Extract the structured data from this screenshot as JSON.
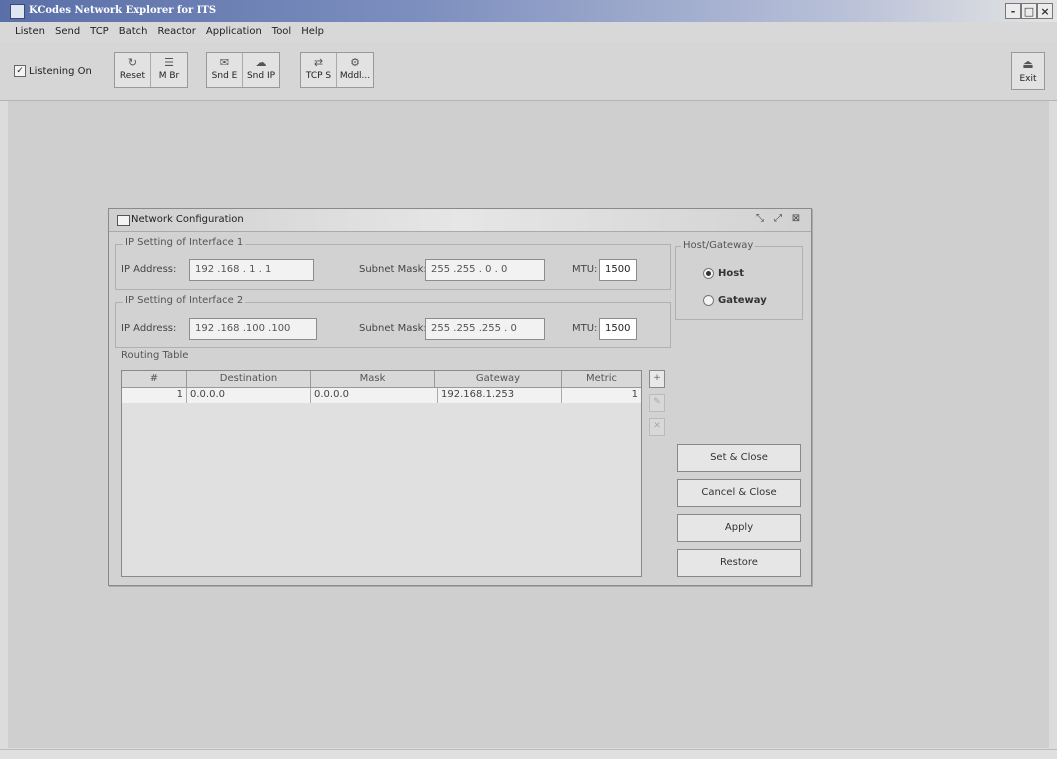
{
  "window": {
    "title": "KCodes Network Explorer for ITS",
    "min": "-",
    "max": "□",
    "close": "×"
  },
  "menu": [
    "Listen",
    "Send",
    "TCP",
    "Batch",
    "Reactor",
    "Application",
    "Tool",
    "Help"
  ],
  "toolbar": {
    "listening_label": "Listening On",
    "listening_checked": true,
    "group1": [
      {
        "label": "Reset",
        "icon": "reset-icon"
      },
      {
        "label": "M Br",
        "icon": "message-icon"
      }
    ],
    "group2": [
      {
        "label": "Snd E",
        "icon": "send-ethernet-icon"
      },
      {
        "label": "Snd IP",
        "icon": "send-ip-icon"
      }
    ],
    "group3": [
      {
        "label": "TCP S",
        "icon": "tcp-icon"
      },
      {
        "label": "Mddl...",
        "icon": "middleware-icon"
      }
    ],
    "exit_label": "Exit"
  },
  "dialog": {
    "title": "Network Configuration",
    "iface1": {
      "legend": "IP Setting of Interface 1",
      "ip_label": "IP Address:",
      "ip_value": "192 .168 .  1  .  1",
      "mask_label": "Subnet Mask:",
      "mask_value": "255 .255 .  0  .  0",
      "mtu_label": "MTU:",
      "mtu_value": "1500"
    },
    "iface2": {
      "legend": "IP Setting of Interface 2",
      "ip_label": "IP Address:",
      "ip_value": "192 .168 .100 .100",
      "mask_label": "Subnet Mask:",
      "mask_value": "255 .255 .255 .  0",
      "mtu_label": "MTU:",
      "mtu_value": "1500"
    },
    "routing": {
      "legend": "Routing Table",
      "columns": [
        "#",
        "Destination",
        "Mask",
        "Gateway",
        "Metric"
      ],
      "rows": [
        {
          "num": "1",
          "destination": "0.0.0.0",
          "mask": "0.0.0.0",
          "gateway": "192.168.1.253",
          "metric": "1"
        }
      ]
    },
    "host_gateway": {
      "legend": "Host/Gateway",
      "host_label": "Host",
      "gateway_label": "Gateway",
      "selected": "Host"
    },
    "buttons": {
      "set_close": "Set & Close",
      "cancel_close": "Cancel & Close",
      "apply": "Apply",
      "restore": "Restore"
    }
  }
}
